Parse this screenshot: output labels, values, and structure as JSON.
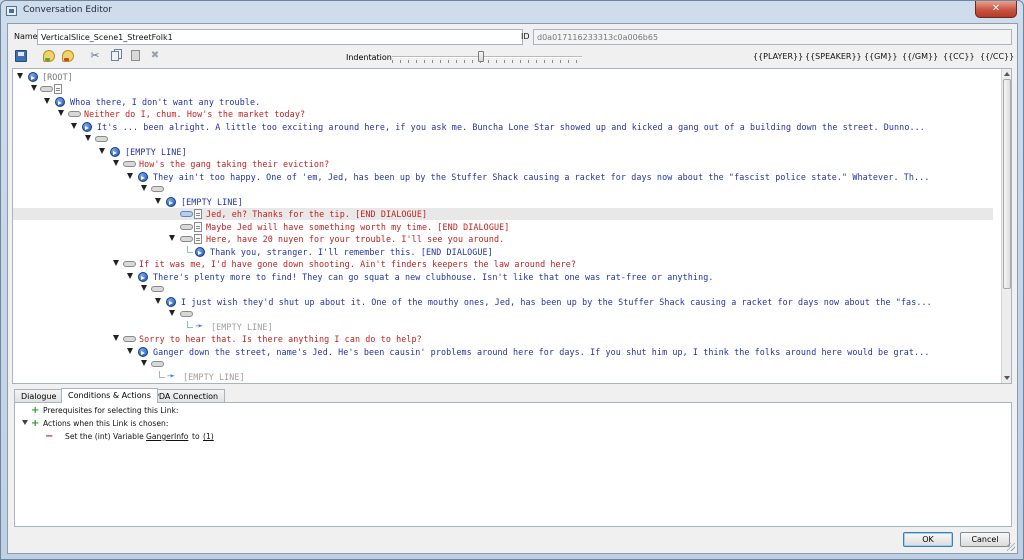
{
  "window": {
    "title": "Conversation Editor",
    "close_glyph": "✕"
  },
  "header": {
    "name_label": "Name",
    "name_value": "VerticalSlice_Scene1_StreetFolk1",
    "id_label": "ID",
    "id_value": "d0a017116233313c0a006b65"
  },
  "toolbar": {
    "icons": [
      "save-icon",
      "add-npc-node-icon",
      "add-player-node-icon",
      "cut-icon",
      "copy-icon",
      "paste-icon",
      "delete-icon"
    ],
    "indentation_label": "Indentation",
    "indentation_level": 0.47,
    "tags": [
      "{{PLAYER}}",
      "{{SPEAKER}}",
      "{{GM}}",
      "{{/GM}}",
      "{{CC}}",
      "{{/CC}}"
    ]
  },
  "tree": {
    "rows": [
      {
        "text": "[ROOT]"
      },
      {
        "text": ""
      },
      {
        "text": "Whoa there, I don't want any trouble."
      },
      {
        "text": "Neither do I, chum. How's the market today?"
      },
      {
        "text": "It's ... been alright. A little too exciting around here, if you ask me. Buncha Lone Star showed up and kicked a gang out of a building down the street. Dunno..."
      },
      {
        "text": ""
      },
      {
        "text": "[EMPTY LINE]"
      },
      {
        "text": "How's the gang taking their eviction?"
      },
      {
        "text": "They ain't too happy. One of 'em, Jed, has been up by the Stuffer Shack causing a racket for days now about the \"fascist police state.\" Whatever. Th..."
      },
      {
        "text": ""
      },
      {
        "text": "[EMPTY LINE]"
      },
      {
        "text": "Jed, eh? Thanks for the tip. [END DIALOGUE]"
      },
      {
        "text": "Maybe Jed will have something worth my time. [END DIALOGUE]"
      },
      {
        "text": "Here, have 20 nuyen for your trouble. I'll see you around."
      },
      {
        "text": "Thank you, stranger. I'll remember this. [END DIALOGUE]"
      },
      {
        "text": "If it was me, I'd have gone down shooting. Ain't finders keepers the law around here?"
      },
      {
        "text": "There's plenty more to find! They can go squat a new clubhouse. Isn't like that one was rat-free or anything."
      },
      {
        "text": ""
      },
      {
        "text": "I just wish they'd shut up about it. One of the mouthy ones, Jed, has been up by the Stuffer Shack causing a racket for days now about the \"fas..."
      },
      {
        "text": ""
      },
      {
        "text": "[EMPTY LINE]"
      },
      {
        "text": "Sorry to hear that. Is there anything I can do to help?"
      },
      {
        "text": "Ganger down the street, name's Jed. He's been causin' problems around here for days. If you shut him up, I think the folks around here would be grat..."
      },
      {
        "text": ""
      },
      {
        "text": "[EMPTY LINE]"
      }
    ]
  },
  "tabs": [
    {
      "label": "Dialogue"
    },
    {
      "label": "Conditions & Actions"
    },
    {
      "label": "PDA Connection"
    }
  ],
  "conditions": {
    "prereq_label": "Prerequisites for selecting this Link:",
    "actions_label": "Actions when this Link is chosen:",
    "action": {
      "prefix": "Set the (int) Variable",
      "variable": "GangerInfo",
      "to_word": "to",
      "value": "(1)"
    }
  },
  "buttons": {
    "ok": "OK",
    "cancel": "Cancel"
  },
  "colors": {
    "npc_text": "#2233a8",
    "player_text": "#c22020",
    "disabled_text": "#a0a0a0",
    "selection": "#e8e8e8"
  }
}
